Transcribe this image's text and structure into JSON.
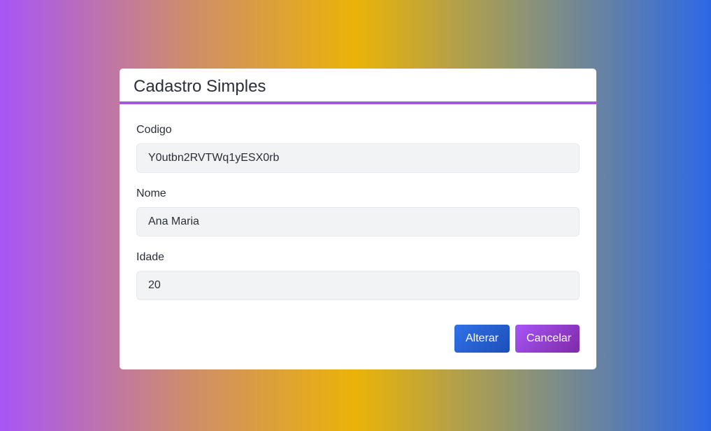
{
  "dialog": {
    "title": "Cadastro Simples",
    "accent_color": "#a855e6"
  },
  "form": {
    "fields": [
      {
        "label": "Codigo",
        "value": "Y0utbn2RVTWq1yESX0rb"
      },
      {
        "label": "Nome",
        "value": "Ana Maria"
      },
      {
        "label": "Idade",
        "value": "20"
      }
    ]
  },
  "actions": {
    "alterar_label": "Alterar",
    "cancelar_label": "Cancelar"
  },
  "colors": {
    "background_gradient": [
      "#a855f7",
      "#eab308",
      "#2d68e6"
    ],
    "primary_button": "#2c6ae0",
    "secondary_button": "#9b4be6"
  }
}
